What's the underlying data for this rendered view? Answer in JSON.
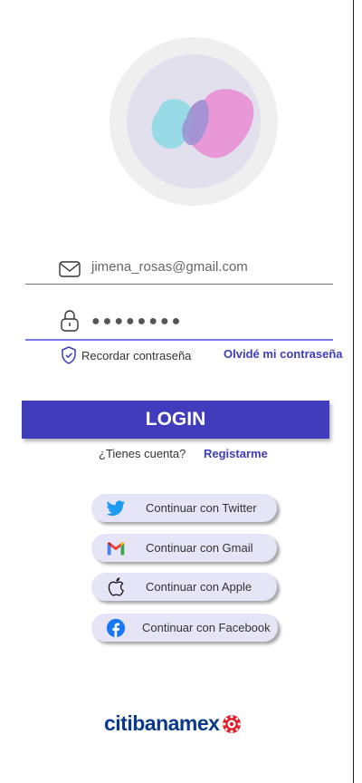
{
  "login_form": {
    "email_value": "jimena_rosas@gmail.com",
    "password_value": "●●●●●●●●",
    "remember_label": "Recordar contraseña",
    "forgot_label": "Olvidé mi contraseña",
    "login_button": "LOGIN",
    "account_question": "¿Tienes cuenta?",
    "register_label": "Registarme"
  },
  "social_buttons": [
    {
      "label": "Continuar con Twitter",
      "icon": "twitter-icon"
    },
    {
      "label": "Continuar con Gmail",
      "icon": "gmail-icon"
    },
    {
      "label": "Continuar con Apple",
      "icon": "apple-icon"
    },
    {
      "label": "Continuar con Facebook",
      "icon": "facebook-icon"
    }
  ],
  "brand": {
    "part1": "citi",
    "part2": "banamex"
  },
  "colors": {
    "primary": "#403cbb",
    "link": "#3f3db9",
    "social_bg": "#e6e5f7",
    "heart_pink": "#e98bd4",
    "heart_cyan": "#7fd8e3",
    "brand_blue": "#0a3a8c",
    "brand_red": "#e0202d"
  }
}
